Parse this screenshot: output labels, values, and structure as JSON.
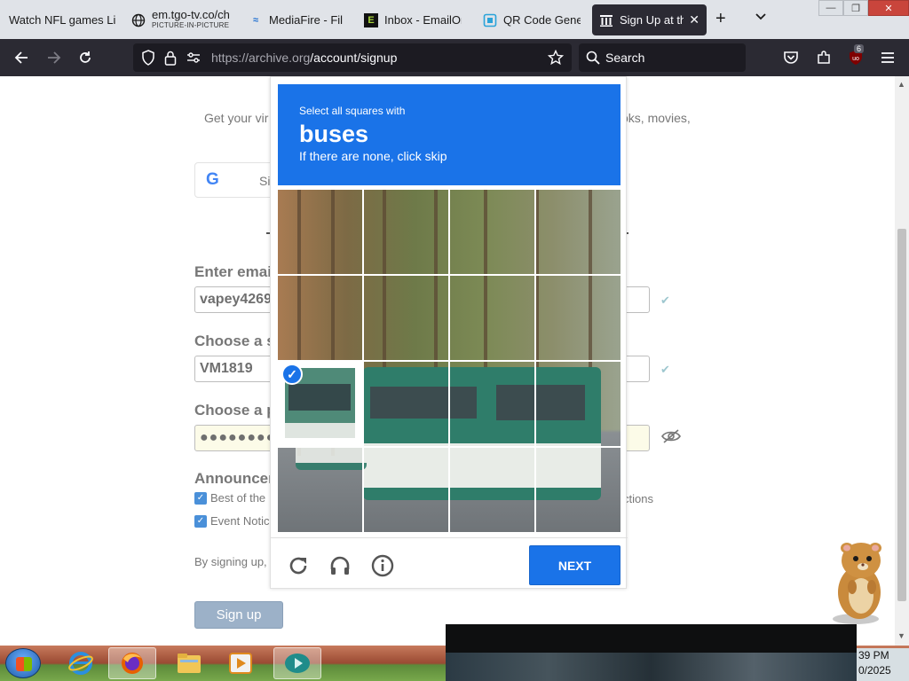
{
  "browser": {
    "tabs": [
      {
        "title": "Watch NFL games Li",
        "subtitle": "",
        "active": false,
        "icon": "page-icon"
      },
      {
        "title": "em.tgo-tv.co/ch",
        "subtitle": "PICTURE-IN-PICTURE",
        "active": false,
        "icon": "globe-icon"
      },
      {
        "title": "MediaFire - Files",
        "subtitle": "",
        "active": false,
        "icon": "mediafire-icon"
      },
      {
        "title": "Inbox - EmailOnl",
        "subtitle": "",
        "active": false,
        "icon": "emailondeck-icon"
      },
      {
        "title": "QR Code Genera",
        "subtitle": "",
        "active": false,
        "icon": "qr-icon"
      },
      {
        "title": "Sign Up at the",
        "subtitle": "",
        "active": true,
        "icon": "archive-icon"
      }
    ],
    "url_host": "https://archive.org",
    "url_path": "/account/signup",
    "search_placeholder": "Search",
    "extension_badge": "6"
  },
  "page": {
    "tagline_left": "Get your vir",
    "tagline_right": "oks, movies,",
    "google_label": "Si",
    "email": {
      "label": "Enter email",
      "value": "vapey4269"
    },
    "screenname": {
      "label": "Choose a s",
      "value": "VM1819"
    },
    "password": {
      "label": "Choose a p",
      "value": "●●●●●●●●"
    },
    "announcements": {
      "label": "Announcen",
      "items": [
        "Best of the",
        "Event Notic"
      ],
      "tail": "ctions"
    },
    "terms": "By signing up,",
    "signup_button": "Sign up"
  },
  "captcha": {
    "instruction": "Select all squares with",
    "target": "buses",
    "hint": "If there are none, click skip",
    "next_label": "NEXT",
    "selected_cells": [
      9
    ]
  },
  "taskbar": {
    "clock_time": "39 PM",
    "clock_date": "0/2025"
  },
  "colors": {
    "captcha_blue": "#1a73e8",
    "browser_dark": "#2b2a33",
    "signup_button": "#9cb1c8"
  }
}
